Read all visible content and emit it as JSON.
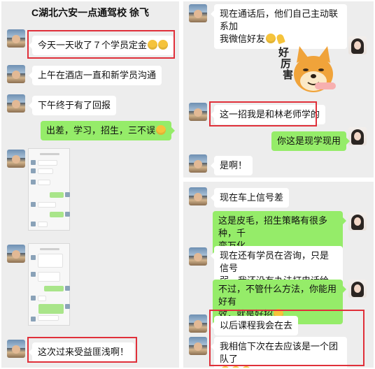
{
  "left_panel": {
    "title": "C湖北六安一点通驾校 徐飞",
    "messages": [
      {
        "text": "今天一天收了７个学员定金"
      },
      {
        "text": "上午在酒店一直和新学员沟通"
      },
      {
        "text": "下午终于有了回报"
      },
      {
        "text": "出差，学习，招生，三不误"
      },
      {
        "text": "这次过来受益匪浅啊！"
      }
    ]
  },
  "right_top": {
    "messages": [
      {
        "text_line1": "现在通话后，他们自己主动联系加",
        "text_line2": "我微信好友"
      },
      {
        "text": "这一招我是和林老师学的"
      },
      {
        "text": "你这是现学现用"
      },
      {
        "text": "是啊！"
      }
    ],
    "sticker": {
      "text_line1": "好",
      "text_line2": "厉",
      "text_line3": "害"
    }
  },
  "right_bottom": {
    "messages": [
      {
        "text": "现在车上信号差"
      },
      {
        "text_line1": "这是皮毛，招生策略有很多种，千",
        "text_line2": "变万化"
      },
      {
        "text_line1": "现在还有学员在咨询，只是信号",
        "text_line2": "弱，我还没有办法打电话给客户"
      },
      {
        "text_line1": "不过，不管什么方法，你能用好有",
        "text_line2": "效，就是好招"
      },
      {
        "text": "以后课程我会在去"
      },
      {
        "text": "我相信下次在去应该是一个团队了"
      }
    ]
  },
  "colors": {
    "highlight": "#e0303a",
    "bubble_green": "#95ec69",
    "chat_bg": "#ededed",
    "emoji": "#f5c33b"
  },
  "icons": [
    "grin-emoji-icon",
    "smile-emoji-icon",
    "clap-hand-icon",
    "shiba-dog-sticker"
  ]
}
